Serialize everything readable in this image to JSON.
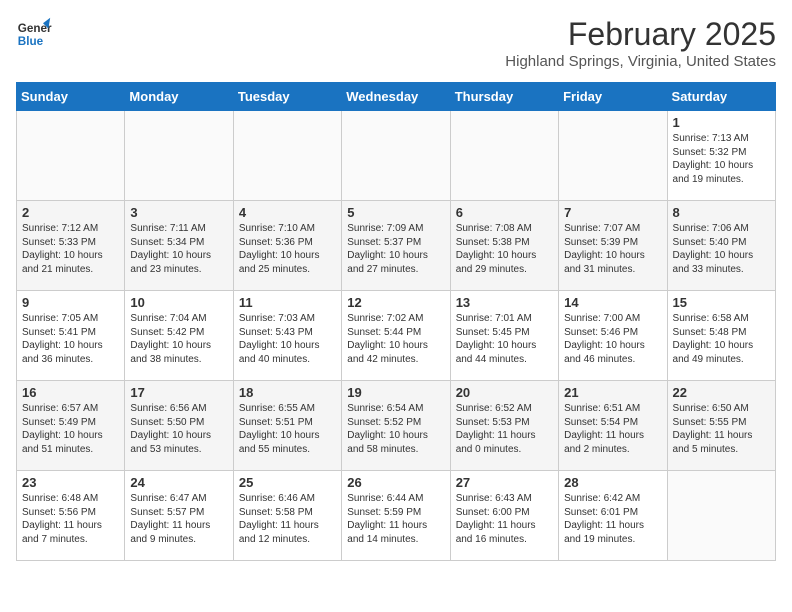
{
  "logo": {
    "line1": "General",
    "line2": "Blue"
  },
  "title": "February 2025",
  "subtitle": "Highland Springs, Virginia, United States",
  "weekdays": [
    "Sunday",
    "Monday",
    "Tuesday",
    "Wednesday",
    "Thursday",
    "Friday",
    "Saturday"
  ],
  "weeks": [
    [
      {
        "day": "",
        "info": ""
      },
      {
        "day": "",
        "info": ""
      },
      {
        "day": "",
        "info": ""
      },
      {
        "day": "",
        "info": ""
      },
      {
        "day": "",
        "info": ""
      },
      {
        "day": "",
        "info": ""
      },
      {
        "day": "1",
        "info": "Sunrise: 7:13 AM\nSunset: 5:32 PM\nDaylight: 10 hours\nand 19 minutes."
      }
    ],
    [
      {
        "day": "2",
        "info": "Sunrise: 7:12 AM\nSunset: 5:33 PM\nDaylight: 10 hours\nand 21 minutes."
      },
      {
        "day": "3",
        "info": "Sunrise: 7:11 AM\nSunset: 5:34 PM\nDaylight: 10 hours\nand 23 minutes."
      },
      {
        "day": "4",
        "info": "Sunrise: 7:10 AM\nSunset: 5:36 PM\nDaylight: 10 hours\nand 25 minutes."
      },
      {
        "day": "5",
        "info": "Sunrise: 7:09 AM\nSunset: 5:37 PM\nDaylight: 10 hours\nand 27 minutes."
      },
      {
        "day": "6",
        "info": "Sunrise: 7:08 AM\nSunset: 5:38 PM\nDaylight: 10 hours\nand 29 minutes."
      },
      {
        "day": "7",
        "info": "Sunrise: 7:07 AM\nSunset: 5:39 PM\nDaylight: 10 hours\nand 31 minutes."
      },
      {
        "day": "8",
        "info": "Sunrise: 7:06 AM\nSunset: 5:40 PM\nDaylight: 10 hours\nand 33 minutes."
      }
    ],
    [
      {
        "day": "9",
        "info": "Sunrise: 7:05 AM\nSunset: 5:41 PM\nDaylight: 10 hours\nand 36 minutes."
      },
      {
        "day": "10",
        "info": "Sunrise: 7:04 AM\nSunset: 5:42 PM\nDaylight: 10 hours\nand 38 minutes."
      },
      {
        "day": "11",
        "info": "Sunrise: 7:03 AM\nSunset: 5:43 PM\nDaylight: 10 hours\nand 40 minutes."
      },
      {
        "day": "12",
        "info": "Sunrise: 7:02 AM\nSunset: 5:44 PM\nDaylight: 10 hours\nand 42 minutes."
      },
      {
        "day": "13",
        "info": "Sunrise: 7:01 AM\nSunset: 5:45 PM\nDaylight: 10 hours\nand 44 minutes."
      },
      {
        "day": "14",
        "info": "Sunrise: 7:00 AM\nSunset: 5:46 PM\nDaylight: 10 hours\nand 46 minutes."
      },
      {
        "day": "15",
        "info": "Sunrise: 6:58 AM\nSunset: 5:48 PM\nDaylight: 10 hours\nand 49 minutes."
      }
    ],
    [
      {
        "day": "16",
        "info": "Sunrise: 6:57 AM\nSunset: 5:49 PM\nDaylight: 10 hours\nand 51 minutes."
      },
      {
        "day": "17",
        "info": "Sunrise: 6:56 AM\nSunset: 5:50 PM\nDaylight: 10 hours\nand 53 minutes."
      },
      {
        "day": "18",
        "info": "Sunrise: 6:55 AM\nSunset: 5:51 PM\nDaylight: 10 hours\nand 55 minutes."
      },
      {
        "day": "19",
        "info": "Sunrise: 6:54 AM\nSunset: 5:52 PM\nDaylight: 10 hours\nand 58 minutes."
      },
      {
        "day": "20",
        "info": "Sunrise: 6:52 AM\nSunset: 5:53 PM\nDaylight: 11 hours\nand 0 minutes."
      },
      {
        "day": "21",
        "info": "Sunrise: 6:51 AM\nSunset: 5:54 PM\nDaylight: 11 hours\nand 2 minutes."
      },
      {
        "day": "22",
        "info": "Sunrise: 6:50 AM\nSunset: 5:55 PM\nDaylight: 11 hours\nand 5 minutes."
      }
    ],
    [
      {
        "day": "23",
        "info": "Sunrise: 6:48 AM\nSunset: 5:56 PM\nDaylight: 11 hours\nand 7 minutes."
      },
      {
        "day": "24",
        "info": "Sunrise: 6:47 AM\nSunset: 5:57 PM\nDaylight: 11 hours\nand 9 minutes."
      },
      {
        "day": "25",
        "info": "Sunrise: 6:46 AM\nSunset: 5:58 PM\nDaylight: 11 hours\nand 12 minutes."
      },
      {
        "day": "26",
        "info": "Sunrise: 6:44 AM\nSunset: 5:59 PM\nDaylight: 11 hours\nand 14 minutes."
      },
      {
        "day": "27",
        "info": "Sunrise: 6:43 AM\nSunset: 6:00 PM\nDaylight: 11 hours\nand 16 minutes."
      },
      {
        "day": "28",
        "info": "Sunrise: 6:42 AM\nSunset: 6:01 PM\nDaylight: 11 hours\nand 19 minutes."
      },
      {
        "day": "",
        "info": ""
      }
    ]
  ]
}
